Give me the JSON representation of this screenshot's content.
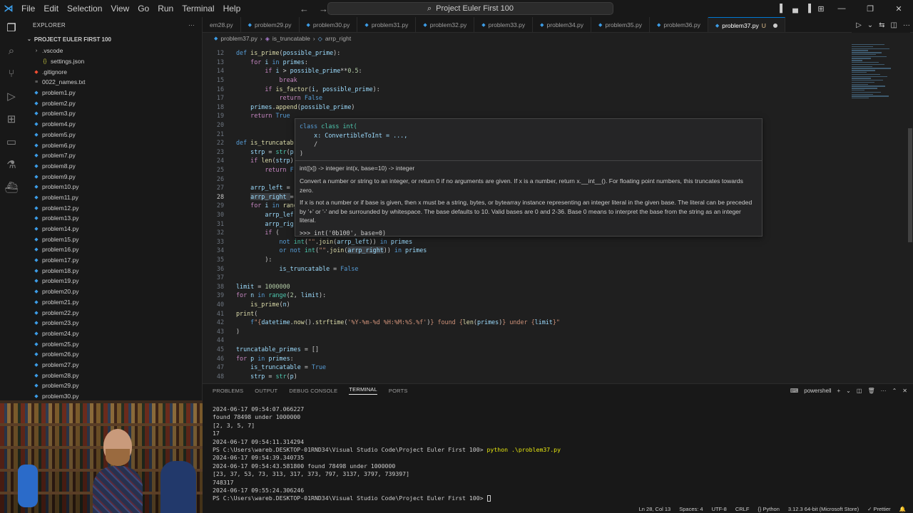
{
  "titlebar": {
    "menu": [
      "File",
      "Edit",
      "Selection",
      "View",
      "Go",
      "Run",
      "Terminal",
      "Help"
    ],
    "search_text": "Project Euler First 100"
  },
  "sidebar": {
    "header": "EXPLORER",
    "project": "PROJECT EULER FIRST 100",
    "items": [
      {
        "label": ".vscode",
        "type": "folder",
        "indent": 1
      },
      {
        "label": "settings.json",
        "type": "json",
        "indent": 2
      },
      {
        "label": ".gitignore",
        "type": "git",
        "indent": 1
      },
      {
        "label": "0022_names.txt",
        "type": "txt",
        "indent": 1
      },
      {
        "label": "problem1.py",
        "type": "py",
        "indent": 1
      },
      {
        "label": "problem2.py",
        "type": "py",
        "indent": 1
      },
      {
        "label": "problem3.py",
        "type": "py",
        "indent": 1
      },
      {
        "label": "problem4.py",
        "type": "py",
        "indent": 1
      },
      {
        "label": "problem5.py",
        "type": "py",
        "indent": 1
      },
      {
        "label": "problem6.py",
        "type": "py",
        "indent": 1
      },
      {
        "label": "problem7.py",
        "type": "py",
        "indent": 1
      },
      {
        "label": "problem8.py",
        "type": "py",
        "indent": 1
      },
      {
        "label": "problem9.py",
        "type": "py",
        "indent": 1
      },
      {
        "label": "problem10.py",
        "type": "py",
        "indent": 1
      },
      {
        "label": "problem11.py",
        "type": "py",
        "indent": 1
      },
      {
        "label": "problem12.py",
        "type": "py",
        "indent": 1
      },
      {
        "label": "problem13.py",
        "type": "py",
        "indent": 1
      },
      {
        "label": "problem14.py",
        "type": "py",
        "indent": 1
      },
      {
        "label": "problem15.py",
        "type": "py",
        "indent": 1
      },
      {
        "label": "problem16.py",
        "type": "py",
        "indent": 1
      },
      {
        "label": "problem17.py",
        "type": "py",
        "indent": 1
      },
      {
        "label": "problem18.py",
        "type": "py",
        "indent": 1
      },
      {
        "label": "problem19.py",
        "type": "py",
        "indent": 1
      },
      {
        "label": "problem20.py",
        "type": "py",
        "indent": 1
      },
      {
        "label": "problem21.py",
        "type": "py",
        "indent": 1
      },
      {
        "label": "problem22.py",
        "type": "py",
        "indent": 1
      },
      {
        "label": "problem23.py",
        "type": "py",
        "indent": 1
      },
      {
        "label": "problem24.py",
        "type": "py",
        "indent": 1
      },
      {
        "label": "problem25.py",
        "type": "py",
        "indent": 1
      },
      {
        "label": "problem26.py",
        "type": "py",
        "indent": 1
      },
      {
        "label": "problem27.py",
        "type": "py",
        "indent": 1
      },
      {
        "label": "problem28.py",
        "type": "py",
        "indent": 1
      },
      {
        "label": "problem29.py",
        "type": "py",
        "indent": 1
      },
      {
        "label": "problem30.py",
        "type": "py",
        "indent": 1
      }
    ]
  },
  "tabs": [
    {
      "label": "em28.py"
    },
    {
      "label": "problem29.py"
    },
    {
      "label": "problem30.py"
    },
    {
      "label": "problem31.py"
    },
    {
      "label": "problem32.py"
    },
    {
      "label": "problem33.py"
    },
    {
      "label": "problem34.py"
    },
    {
      "label": "problem35.py"
    },
    {
      "label": "problem36.py"
    },
    {
      "label": "problem37.py",
      "active": true,
      "modified": "U"
    }
  ],
  "breadcrumb": {
    "file": "problem37.py",
    "fn": "is_truncatable",
    "var": "arrp_right"
  },
  "editor": {
    "current_line": 28,
    "lines": [
      {
        "n": 12,
        "t": [
          [
            "kwd",
            "def "
          ],
          [
            "fn",
            "is_prime"
          ],
          [
            "",
            "("
          ],
          [
            "var",
            "possible_prime"
          ],
          [
            "",
            "):"
          ]
        ]
      },
      {
        "n": 13,
        "t": [
          [
            "",
            "    "
          ],
          [
            "kw",
            "for "
          ],
          [
            "var",
            "i "
          ],
          [
            "kwd",
            "in "
          ],
          [
            "var",
            "primes"
          ],
          [
            "",
            ":"
          ]
        ]
      },
      {
        "n": 14,
        "t": [
          [
            "",
            "        "
          ],
          [
            "kw",
            "if "
          ],
          [
            "var",
            "i "
          ],
          [
            "",
            "> "
          ],
          [
            "var",
            "possible_prime"
          ],
          [
            "",
            "**"
          ],
          [
            "num",
            "0.5"
          ],
          [
            "",
            ":"
          ]
        ]
      },
      {
        "n": 15,
        "t": [
          [
            "",
            "            "
          ],
          [
            "kw",
            "break"
          ]
        ]
      },
      {
        "n": 16,
        "t": [
          [
            "",
            "        "
          ],
          [
            "kw",
            "if "
          ],
          [
            "fn",
            "is_factor"
          ],
          [
            "",
            "("
          ],
          [
            "var",
            "i"
          ],
          [
            "",
            ", "
          ],
          [
            "var",
            "possible_prime"
          ],
          [
            "",
            "):"
          ]
        ]
      },
      {
        "n": 17,
        "t": [
          [
            "",
            "            "
          ],
          [
            "kw",
            "return "
          ],
          [
            "kwd",
            "False"
          ]
        ]
      },
      {
        "n": 18,
        "t": [
          [
            "",
            "    "
          ],
          [
            "var",
            "primes"
          ],
          [
            "",
            "."
          ],
          [
            "fn",
            "append"
          ],
          [
            "",
            "("
          ],
          [
            "var",
            "possible_prime"
          ],
          [
            "",
            ")"
          ]
        ]
      },
      {
        "n": 19,
        "t": [
          [
            "",
            "    "
          ],
          [
            "kw",
            "return "
          ],
          [
            "kwd",
            "True"
          ]
        ]
      },
      {
        "n": 20,
        "t": []
      },
      {
        "n": 21,
        "t": []
      },
      {
        "n": 22,
        "t": [
          [
            "kwd",
            "def "
          ],
          [
            "fn",
            "is_truncatab"
          ]
        ]
      },
      {
        "n": 23,
        "t": [
          [
            "",
            "    "
          ],
          [
            "var",
            "strp "
          ],
          [
            "",
            "= "
          ],
          [
            "cls",
            "str"
          ],
          [
            "",
            "("
          ],
          [
            "var",
            "p"
          ]
        ]
      },
      {
        "n": 24,
        "t": [
          [
            "",
            "    "
          ],
          [
            "kw",
            "if "
          ],
          [
            "fn",
            "len"
          ],
          [
            "",
            "("
          ],
          [
            "var",
            "strp"
          ],
          [
            "",
            ")"
          ]
        ]
      },
      {
        "n": 25,
        "t": [
          [
            "",
            "        "
          ],
          [
            "kw",
            "return "
          ],
          [
            "kwd",
            "F"
          ]
        ]
      },
      {
        "n": 26,
        "t": []
      },
      {
        "n": 27,
        "t": [
          [
            "",
            "    "
          ],
          [
            "var",
            "arrp_left "
          ],
          [
            "",
            "="
          ]
        ]
      },
      {
        "n": 28,
        "t": [
          [
            "",
            "    "
          ],
          [
            "var",
            "arrp_right "
          ],
          [
            "",
            "="
          ]
        ]
      },
      {
        "n": 29,
        "t": [
          [
            "",
            "    "
          ],
          [
            "kw",
            "for "
          ],
          [
            "var",
            "i "
          ],
          [
            "kwd",
            "in "
          ],
          [
            "fn",
            "rang"
          ]
        ]
      },
      {
        "n": 30,
        "t": [
          [
            "",
            "        "
          ],
          [
            "var",
            "arrp_lef"
          ]
        ]
      },
      {
        "n": 31,
        "t": [
          [
            "",
            "        "
          ],
          [
            "var",
            "arrp_rig"
          ]
        ]
      },
      {
        "n": 32,
        "t": [
          [
            "",
            "        "
          ],
          [
            "kw",
            "if "
          ],
          [
            "",
            "("
          ]
        ]
      },
      {
        "n": 33,
        "t": [
          [
            "",
            "            "
          ],
          [
            "kwd",
            "not "
          ],
          [
            "cls",
            "int"
          ],
          [
            "",
            "("
          ],
          [
            "str",
            "\"\""
          ],
          [
            "",
            "."
          ],
          [
            "fn",
            "join"
          ],
          [
            "",
            "("
          ],
          [
            "var",
            "arrp_left"
          ],
          [
            "",
            "))"
          ],
          [
            "kwd",
            " in "
          ],
          [
            "var",
            "primes"
          ]
        ]
      },
      {
        "n": 34,
        "t": [
          [
            "",
            "            "
          ],
          [
            "kwd",
            "or not "
          ],
          [
            "cls",
            "int"
          ],
          [
            "",
            "("
          ],
          [
            "str",
            "\"\""
          ],
          [
            "",
            "."
          ],
          [
            "fn",
            "join"
          ],
          [
            "",
            "("
          ],
          [
            "var",
            "arrp_right"
          ],
          [
            "",
            "))"
          ],
          [
            "kwd",
            " in "
          ],
          [
            "var",
            "primes"
          ]
        ]
      },
      {
        "n": 35,
        "t": [
          [
            "",
            "        "
          ],
          [
            "",
            ")"
          ],
          [
            "",
            ":"
          ]
        ]
      },
      {
        "n": 36,
        "t": [
          [
            "",
            "            "
          ],
          [
            "var",
            "is_truncatable "
          ],
          [
            "",
            "= "
          ],
          [
            "kwd",
            "False"
          ]
        ]
      },
      {
        "n": 37,
        "t": []
      },
      {
        "n": 38,
        "t": [
          [
            "var",
            "limit "
          ],
          [
            "",
            "= "
          ],
          [
            "num",
            "1000000"
          ]
        ]
      },
      {
        "n": 39,
        "t": [
          [
            "kw",
            "for "
          ],
          [
            "var",
            "n "
          ],
          [
            "kwd",
            "in "
          ],
          [
            "cls",
            "range"
          ],
          [
            "",
            "("
          ],
          [
            "num",
            "2"
          ],
          [
            "",
            ", "
          ],
          [
            "var",
            "limit"
          ],
          [
            "",
            "):"
          ]
        ]
      },
      {
        "n": 40,
        "t": [
          [
            "",
            "    "
          ],
          [
            "fn",
            "is_prime"
          ],
          [
            "",
            "("
          ],
          [
            "var",
            "n"
          ],
          [
            "",
            ")"
          ]
        ]
      },
      {
        "n": 41,
        "t": [
          [
            "fn",
            "print"
          ],
          [
            "",
            "("
          ]
        ]
      },
      {
        "n": 42,
        "t": [
          [
            "",
            "    "
          ],
          [
            "kwd",
            "f"
          ],
          [
            "str",
            "\"{"
          ],
          [
            "var",
            "datetime"
          ],
          [
            "",
            "."
          ],
          [
            "fn",
            "now"
          ],
          [
            "",
            "()."
          ],
          [
            "fn",
            "strftime"
          ],
          [
            "",
            "("
          ],
          [
            "str",
            "'%Y-%m-%d %H:%M:%S.%f'"
          ],
          [
            "",
            ")"
          ],
          [
            "str",
            "} found {"
          ],
          [
            "fn",
            "len"
          ],
          [
            "",
            "("
          ],
          [
            "var",
            "primes"
          ],
          [
            "",
            ")"
          ],
          [
            "str",
            "} under {"
          ],
          [
            "var",
            "limit"
          ],
          [
            "str",
            "}\""
          ]
        ]
      },
      {
        "n": 43,
        "t": [
          [
            "",
            ")"
          ]
        ]
      },
      {
        "n": 44,
        "t": []
      },
      {
        "n": 45,
        "t": [
          [
            "var",
            "truncatable_primes "
          ],
          [
            "",
            "= []"
          ]
        ]
      },
      {
        "n": 46,
        "t": [
          [
            "kw",
            "for "
          ],
          [
            "var",
            "p "
          ],
          [
            "kwd",
            "in "
          ],
          [
            "var",
            "primes"
          ],
          [
            "",
            ":"
          ]
        ]
      },
      {
        "n": 47,
        "t": [
          [
            "",
            "    "
          ],
          [
            "var",
            "is_truncatable "
          ],
          [
            "",
            "= "
          ],
          [
            "kwd",
            "True"
          ]
        ]
      },
      {
        "n": 48,
        "t": [
          [
            "",
            "    "
          ],
          [
            "var",
            "strp "
          ],
          [
            "",
            "= "
          ],
          [
            "cls",
            "str"
          ],
          [
            "",
            "("
          ],
          [
            "var",
            "p"
          ],
          [
            "",
            ")"
          ]
        ]
      }
    ]
  },
  "hover": {
    "sig1": "class int(",
    "sig2": "    x: ConvertibleToInt = ...,",
    "sig3": "    /",
    "sig4": ")",
    "doc_sig": "int([x]) -> integer int(x, base=10) -> integer",
    "doc1": "Convert a number or string to an integer, or return 0 if no arguments are given. If x is a number, return x.__int__(). For floating point numbers, this truncates towards zero.",
    "doc2": "If x is not a number or if base is given, then x must be a string, bytes, or bytearray instance representing an integer literal in the given base. The literal can be preceded by '+' or '-' and be surrounded by whitespace. The base defaults to 10. Valid bases are 0 and 2-36. Base 0 means to interpret the base from the string as an integer literal.",
    "example": ">>> int('0b100', base=0)"
  },
  "panel": {
    "tabs": [
      "PROBLEMS",
      "OUTPUT",
      "DEBUG CONSOLE",
      "TERMINAL",
      "PORTS"
    ],
    "shell": "powershell",
    "lines": [
      "2024-06-17 09:54:07.066227",
      "found 78498 under 1000000",
      "[2, 3, 5, 7]",
      "17",
      "2024-06-17 09:54:11.314294",
      "PS C:\\Users\\wareb.DESKTOP-01RND34\\Visual Studio Code\\Project Euler First 100> ",
      "2024-06-17 09:54:39.340735",
      "2024-06-17 09:54:43.581800 found 78498 under 1000000",
      "[23, 37, 53, 73, 313, 317, 373, 797, 3137, 3797, 739397]",
      "748317",
      "2024-06-17 09:55:24.306246",
      "PS C:\\Users\\wareb.DESKTOP-01RND34\\Visual Studio Code\\Project Euler First 100> "
    ],
    "command": "python .\\problem37.py"
  },
  "statusbar": {
    "position": "Ln 28, Col 13",
    "spaces": "Spaces: 4",
    "encoding": "UTF-8",
    "eol": "CRLF",
    "language": "Python",
    "interpreter": "3.12.3 64-bit (Microsoft Store)",
    "formatter": "Prettier"
  }
}
